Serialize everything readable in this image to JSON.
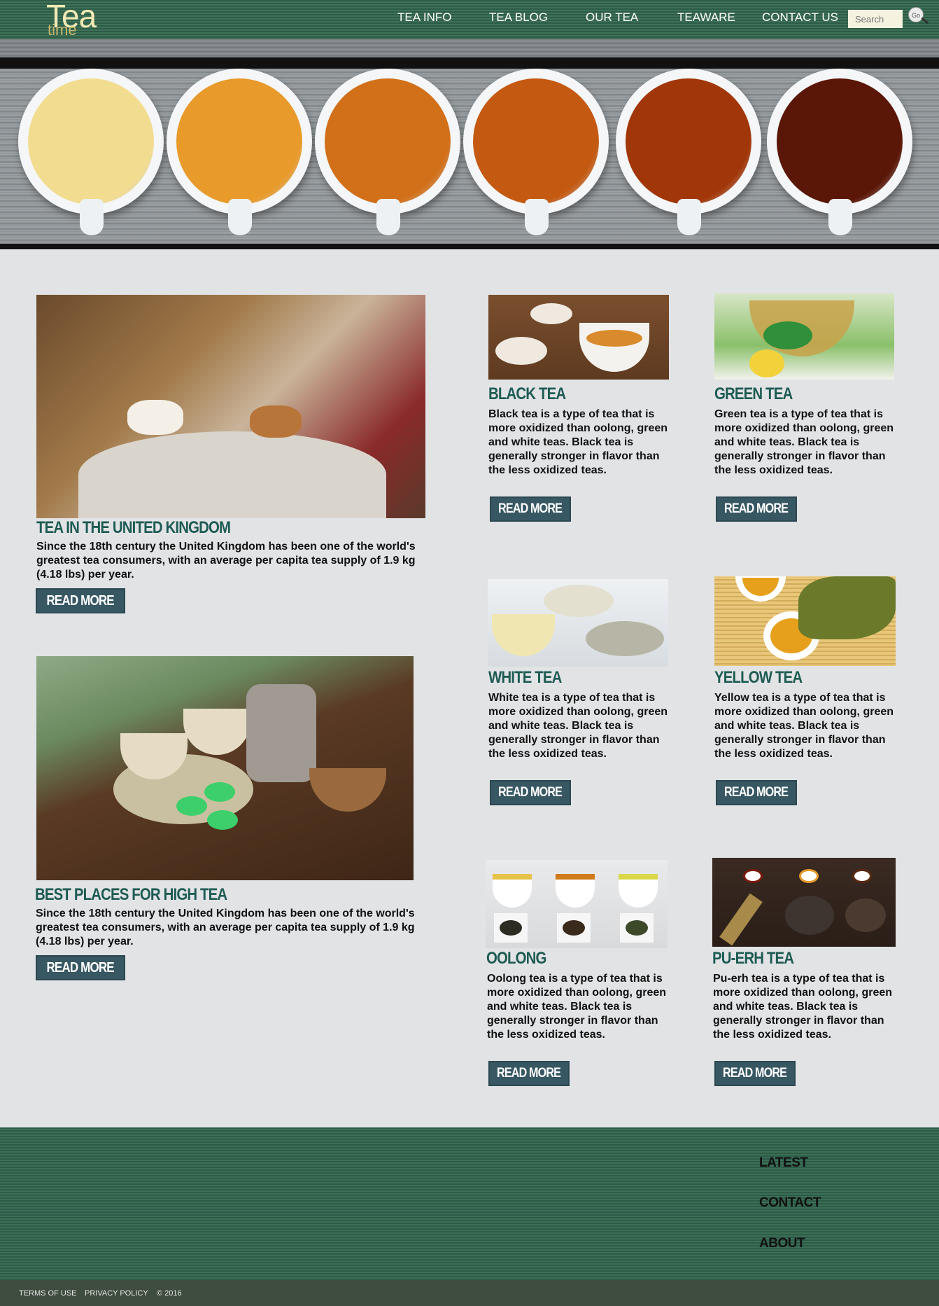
{
  "header": {
    "logo_main": "Tea",
    "logo_sub": "time",
    "nav": [
      "TEA INFO",
      "TEA BLOG",
      "OUR TEA",
      "TEAWARE",
      "CONTACT US"
    ],
    "search_placeholder": "Search",
    "go_label": "Go"
  },
  "hero": {
    "cup_colors": [
      "#f2dc8f",
      "#e89a2a",
      "#d2701a",
      "#c45a12",
      "#a13608",
      "#5a1606"
    ]
  },
  "features": [
    {
      "title": "TEA IN THE UNITED KINGDOM",
      "text": "Since the 18th century the United Kingdom has been one of the world's greatest tea consumers, with an average per capita tea supply of 1.9 kg (4.18 lbs) per year.",
      "button": "READ MORE"
    },
    {
      "title": "BEST PLACES FOR HIGH TEA",
      "text": "Since the 18th century the United Kingdom has been one of the world's greatest tea consumers, with an average per capita tea supply of 1.9 kg (4.18 lbs) per year.",
      "button": "READ MORE"
    }
  ],
  "teas": [
    {
      "title": "BLACK TEA",
      "text": "Black tea is a type of tea that is more oxidized than oolong, green and white teas. Black tea is generally stronger in flavor than the less oxidized teas.",
      "button": "READ MORE"
    },
    {
      "title": "GREEN TEA",
      "text": "Green tea is a type of tea that is more oxidized than oolong, green and white teas. Black tea is generally stronger in flavor than the less oxidized teas.",
      "button": "READ MORE"
    },
    {
      "title": "WHITE TEA",
      "text": "White tea is a type of tea that is more oxidized than oolong, green and white teas. Black tea is generally stronger in flavor than the less oxidized teas.",
      "button": "READ MORE"
    },
    {
      "title": "YELLOW TEA",
      "text": "Yellow tea is a type of tea that is more oxidized than oolong, green and white teas. Black tea is generally stronger in flavor than the less oxidized teas.",
      "button": "READ MORE"
    },
    {
      "title": "OOLONG",
      "text": "Oolong tea is a type of tea that is more oxidized than oolong, green and white teas. Black tea is generally stronger in flavor than the less oxidized teas.",
      "button": "READ MORE"
    },
    {
      "title": "PU-ERH TEA",
      "text": "Pu-erh tea is a type of tea that is more oxidized than oolong, green and white teas. Black tea is generally stronger in flavor than the less oxidized teas.",
      "button": "READ MORE"
    }
  ],
  "footer": {
    "links": [
      "LATEST",
      "CONTACT",
      "ABOUT"
    ],
    "bottom": [
      "TERMS OF USE",
      "PRIVACY POLICY",
      "© 2016"
    ]
  }
}
